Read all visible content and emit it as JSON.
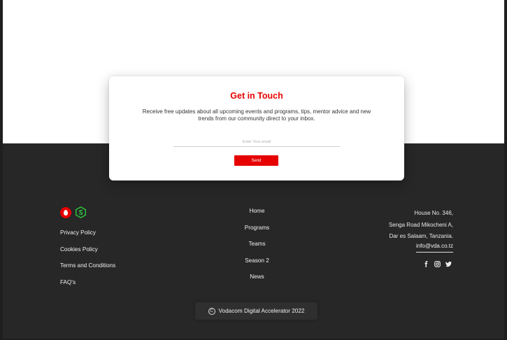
{
  "subscribe": {
    "title": "Get in Touch",
    "description": "Receive free updates about all upcoming events and programs, tips, mentor advice and new trends from our community direct to your inbox.",
    "email_placeholder": "Enter Your email",
    "send_label": "Send"
  },
  "footer": {
    "left_links": [
      "Privacy Policy",
      "Cookies Policy",
      "Terms and Conditions",
      "FAQ's"
    ],
    "nav_links": [
      "Home",
      "Programs",
      "Teams",
      "Season 2",
      "News"
    ],
    "address_lines": [
      "House No. 346,",
      "Senga Road Mikocheni A,",
      "Dar es Salaam, Tanzania."
    ],
    "email": "info@vda.co.tz",
    "social_icons": [
      "facebook-icon",
      "instagram-icon",
      "twitter-icon"
    ],
    "copyright": "Vodacom Digital Accelerator 2022"
  },
  "colors": {
    "accent": "#e60000",
    "footer_bg": "#272727",
    "vda_green": "#2ecc40"
  }
}
